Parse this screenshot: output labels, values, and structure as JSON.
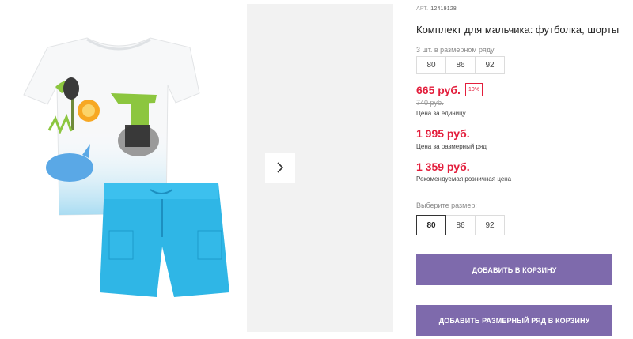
{
  "product": {
    "art_label": "АРТ.",
    "art_number": "12419128",
    "title": "Комплект для мальчика: футболка, шорты",
    "image_icon": "tshirt-shorts-product-photo",
    "print_text": "helloo"
  },
  "gallery": {
    "next_icon": "chevron-right-icon"
  },
  "range": {
    "label": "3 шт. в размерном ряду",
    "sizes": [
      "80",
      "86",
      "92"
    ]
  },
  "prices": {
    "unit_price": "665 руб.",
    "discount": "10%",
    "old_price": "740 руб.",
    "unit_caption": "Цена за единицу",
    "range_price": "1 995 руб.",
    "range_caption": "Цена за размерный ряд",
    "retail_price": "1 359 руб.",
    "retail_caption": "Рекомендуемая розничная цена"
  },
  "size_select": {
    "label": "Выберите размер:",
    "sizes": [
      "80",
      "86",
      "92"
    ],
    "selected": "80"
  },
  "buttons": {
    "add_to_cart": "ДОБАВИТЬ В КОРЗИНУ",
    "add_range_to_cart": "ДОБАВИТЬ РАЗМЕРНЫЙ РЯД В КОРЗИНУ"
  },
  "colors": {
    "price_red": "#e31e3c",
    "button_purple": "#7e6aac",
    "shorts_blue": "#2fb6e6",
    "gallery_bg": "#f2f2f2"
  }
}
